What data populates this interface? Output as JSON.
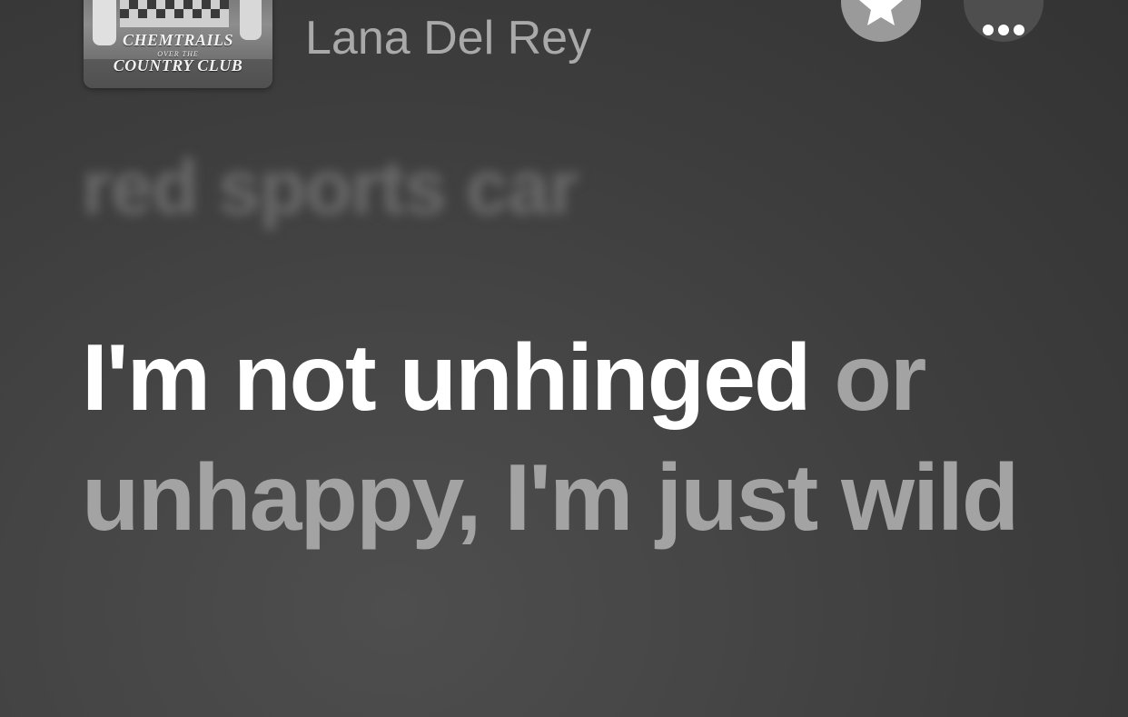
{
  "now_playing": {
    "artwork_text": {
      "line1": "CHEMTRAILS",
      "line2": "OVER THE",
      "line3": "COUNTRY CLUB"
    },
    "artist": "Lana Del Rey",
    "favorite_icon": "star-icon",
    "more_icon": "ellipsis-icon"
  },
  "lyrics": {
    "previous_line": "red sports car",
    "current_line_sung": "I'm not unhinged",
    "current_line_unsung": " or unhappy, I'm just wild"
  },
  "colors": {
    "sung": "#ffffff",
    "unsung": "#a3a3a3",
    "background": "#3d3d3d"
  }
}
